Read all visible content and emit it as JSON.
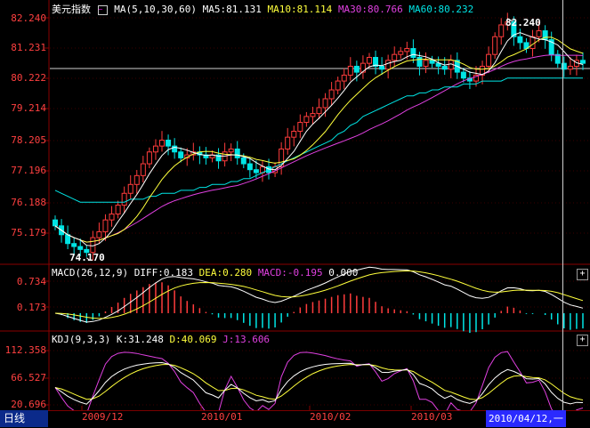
{
  "main": {
    "name": "美元指数",
    "ma_legend": "MA(5,10,30,60)",
    "ma5": "MA5:81.131",
    "ma10": "MA10:81.114",
    "ma30": "MA30:80.766",
    "ma60": "MA60:80.232",
    "high_label": "82.240",
    "low_label": "74.170",
    "y_ticks": [
      "82.240",
      "81.231",
      "80.222",
      "79.214",
      "78.205",
      "77.196",
      "76.188",
      "75.179"
    ]
  },
  "macd": {
    "legend": "MACD(26,12,9)",
    "diff": "DIFF:0.183",
    "dea": "DEA:0.280",
    "macd": "MACD:-0.195",
    "zero": "0.000",
    "y_ticks": [
      "0.734",
      "0.173"
    ]
  },
  "kdj": {
    "legend": "KDJ(9,3,3)",
    "k": "K:31.248",
    "d": "D:40.069",
    "j": "J:13.606",
    "y_ticks": [
      "112.358",
      "66.527",
      "20.696"
    ]
  },
  "x_axis": {
    "labels": [
      "2009/12",
      "2010/01",
      "2010/02",
      "2010/03"
    ]
  },
  "period_tab": "日线",
  "cursor_date": "2010/04/12,一",
  "colors": {
    "up": "#ff3c3c",
    "down": "#00e5e5",
    "ma5": "#ffffff",
    "ma10": "#ffff3c",
    "ma30": "#e040e0",
    "ma60": "#00e5e5",
    "axis": "#8a0000",
    "label": "#ff4040"
  },
  "chart_data": {
    "type": "candlestick",
    "title": "美元指数",
    "ylim": [
      74.17,
      82.24
    ],
    "close": [
      75.2,
      74.9,
      74.6,
      74.5,
      74.4,
      74.3,
      74.8,
      75.0,
      75.4,
      75.6,
      75.9,
      76.3,
      76.6,
      76.9,
      77.3,
      77.7,
      77.9,
      78.1,
      77.9,
      77.7,
      77.5,
      77.6,
      77.7,
      77.6,
      77.5,
      77.6,
      77.4,
      77.7,
      77.8,
      77.5,
      77.3,
      77.1,
      77.0,
      77.2,
      77.0,
      77.2,
      77.8,
      78.2,
      78.4,
      78.7,
      78.9,
      79.0,
      79.2,
      79.5,
      79.8,
      80.1,
      80.3,
      80.6,
      80.4,
      80.7,
      80.9,
      80.6,
      80.5,
      80.8,
      81.0,
      81.1,
      81.2,
      80.9,
      80.6,
      80.8,
      80.7,
      80.6,
      80.5,
      80.8,
      80.4,
      80.2,
      80.1,
      80.3,
      80.6,
      81.0,
      81.6,
      82.0,
      82.1,
      81.6,
      81.4,
      81.2,
      81.6,
      81.8,
      81.5,
      81.0,
      80.7,
      80.5,
      80.6,
      80.8,
      80.7
    ],
    "ma60": [
      76.4,
      76.3,
      76.2,
      76.1,
      76.0,
      76.0,
      76.0,
      76.0,
      76.0,
      76.0,
      76.0,
      76.0,
      76.1,
      76.1,
      76.1,
      76.2,
      76.2,
      76.3,
      76.3,
      76.3,
      76.4,
      76.4,
      76.4,
      76.5,
      76.5,
      76.6,
      76.6,
      76.6,
      76.7,
      76.7,
      76.8,
      76.8,
      76.9,
      77.0,
      77.1,
      77.2,
      77.3,
      77.4,
      77.5,
      77.6,
      77.7,
      77.8,
      77.9,
      78.0,
      78.1,
      78.3,
      78.4,
      78.6,
      78.7,
      78.9,
      79.0,
      79.1,
      79.2,
      79.3,
      79.4,
      79.5,
      79.6,
      79.6,
      79.7,
      79.7,
      79.8,
      79.8,
      79.9,
      79.9,
      79.9,
      80.0,
      80.0,
      80.0,
      80.1,
      80.1,
      80.1,
      80.1,
      80.2,
      80.2,
      80.2,
      80.2,
      80.2,
      80.2,
      80.2,
      80.2,
      80.2,
      80.2,
      80.2,
      80.2,
      80.2
    ]
  }
}
